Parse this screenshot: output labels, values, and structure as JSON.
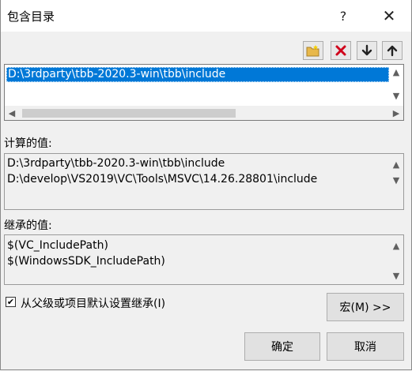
{
  "dialog": {
    "title": "包含目录",
    "help_glyph": "?",
    "close_glyph": "✕"
  },
  "toolbar": {
    "new_icon": "new-folder-icon",
    "delete_icon": "delete-x-icon",
    "down_icon": "arrow-down-icon",
    "up_icon": "arrow-up-icon"
  },
  "list": {
    "items": [
      "D:\\3rdparty\\tbb-2020.3-win\\tbb\\include"
    ]
  },
  "computed": {
    "label": "计算的值:",
    "lines": [
      "D:\\3rdparty\\tbb-2020.3-win\\tbb\\include",
      "D:\\develop\\VS2019\\VC\\Tools\\MSVC\\14.26.28801\\include"
    ]
  },
  "inherited": {
    "label": "继承的值:",
    "lines": [
      "$(VC_IncludePath)",
      "$(WindowsSDK_IncludePath)"
    ]
  },
  "inherit_checkbox": {
    "label": "从父级或项目默认设置继承(I)",
    "checked": true
  },
  "buttons": {
    "macro": "宏(M) >>",
    "ok": "确定",
    "cancel": "取消"
  },
  "colors": {
    "selection": "#0078d7",
    "delete_red": "#d0021b"
  }
}
